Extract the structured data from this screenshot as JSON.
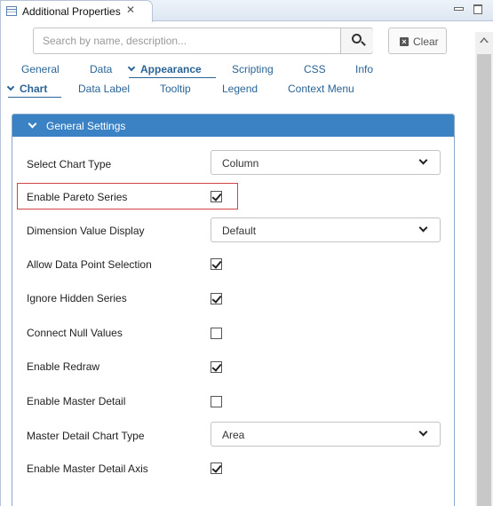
{
  "window": {
    "title": "Additional Properties",
    "close_glyph": "✕"
  },
  "search": {
    "placeholder": "Search by name, description...",
    "value": "",
    "clear_label": "Clear"
  },
  "tabs": [
    {
      "label": "General",
      "active": false
    },
    {
      "label": "Data",
      "active": false
    },
    {
      "label": "Appearance",
      "active": true
    },
    {
      "label": "Scripting",
      "active": false
    },
    {
      "label": "CSS",
      "active": false
    },
    {
      "label": "Info",
      "active": false
    }
  ],
  "subtabs": [
    {
      "label": "Chart",
      "active": true
    },
    {
      "label": "Data Label",
      "active": false
    },
    {
      "label": "Tooltip",
      "active": false
    },
    {
      "label": "Legend",
      "active": false
    },
    {
      "label": "Context Menu",
      "active": false
    }
  ],
  "panel": {
    "title": "General Settings",
    "fields": [
      {
        "label": "Select Chart Type",
        "type": "select",
        "value": "Column"
      },
      {
        "label": "Enable Pareto Series",
        "type": "checkbox",
        "checked": true,
        "highlighted": true
      },
      {
        "label": "Dimension Value Display",
        "type": "select",
        "value": "Default"
      },
      {
        "label": "Allow Data Point Selection",
        "type": "checkbox",
        "checked": true
      },
      {
        "label": "Ignore Hidden Series",
        "type": "checkbox",
        "checked": true
      },
      {
        "label": "Connect Null Values",
        "type": "checkbox",
        "checked": false
      },
      {
        "label": "Enable Redraw",
        "type": "checkbox",
        "checked": true
      },
      {
        "label": "Enable Master Detail",
        "type": "checkbox",
        "checked": false
      },
      {
        "label": "Master Detail Chart Type",
        "type": "select",
        "value": "Area"
      },
      {
        "label": "Enable Master Detail Axis",
        "type": "checkbox",
        "checked": true
      }
    ]
  },
  "colors": {
    "accent": "#3a82c4",
    "link": "#2a6496",
    "highlight_border": "#d04545"
  }
}
